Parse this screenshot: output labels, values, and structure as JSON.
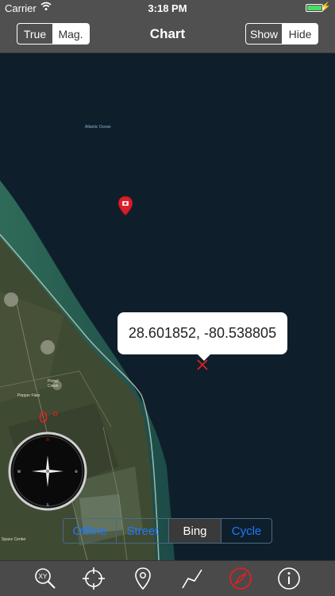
{
  "status_bar": {
    "carrier": "Carrier",
    "time": "3:18 PM",
    "battery_level": 1.0
  },
  "nav": {
    "title": "Chart",
    "north_ref": {
      "options": [
        "True",
        "Mag."
      ],
      "selected": "Mag."
    },
    "overlay_toggle": {
      "options": [
        "Show",
        "Hide"
      ],
      "selected": "Hide"
    }
  },
  "map": {
    "ocean_label": "Atlantic Ocean",
    "labels": {
      "pepper_flats": "Pepper Flats",
      "pintail_creek": "Pintail\nCreek",
      "space_center": "Space Center"
    },
    "callout_coordinates": "28.601852, -80.538805",
    "heading": "0 °",
    "compass_directions": {
      "n": "n",
      "s": "s",
      "e": "e",
      "w": "w"
    },
    "map_types": {
      "options": [
        "Offline",
        "Street",
        "Bing",
        "Cycle"
      ],
      "selected": "Bing"
    }
  },
  "toolbar": {
    "buttons": [
      "xy-search-icon",
      "crosshair-icon",
      "location-pin-icon",
      "route-icon",
      "compass-icon",
      "info-icon"
    ],
    "active": "compass-icon"
  },
  "colors": {
    "bars": "#505050",
    "ocean": "#0e1f2b",
    "accent_blue": "#1f78ff",
    "alert_red": "#e02020",
    "battery_green": "#4cd964"
  }
}
